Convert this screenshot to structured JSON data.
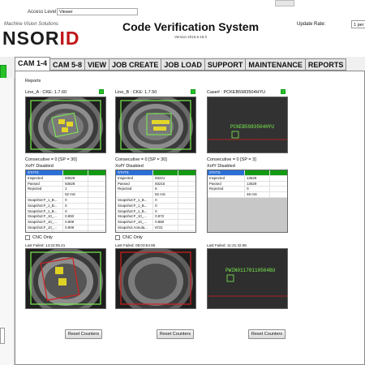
{
  "topbar": {
    "access_level_label": "Access Level",
    "access_level_value": "Viewer"
  },
  "brand": {
    "subtitle": "Machine Vision Solutions",
    "logo_main": "NSOR",
    "logo_accent": "ID"
  },
  "header": {
    "title": "Code Verification System",
    "version": "Version 2016.8.16.0",
    "update_rate_label": "Update Rate:",
    "update_rate_value": "1 per"
  },
  "tabs": [
    "CAM 1-4",
    "CAM 5-8",
    "VIEW",
    "JOB CREATE",
    "JOB LOAD",
    "SUPPORT",
    "MAINTENANCE",
    "REPORTS"
  ],
  "content": {
    "section_label": "Reports"
  },
  "colors": {
    "status_ok": "#27c227",
    "stats_header_blue": "#2b6fd6",
    "stats_header_green": "#129a12",
    "overlay_green": "#7cf050",
    "overlay_red": "#d02020",
    "overlay_yellow": "#f0e020"
  },
  "cameras": [
    {
      "title": "Line_A : CKE: 1.7.60",
      "consecutive": "Consecutive = 0 [SP = 30]",
      "xofy": "XofY Disabled",
      "stats": {
        "header": "STATS",
        "rows": [
          {
            "label": "Inspected",
            "value": "83629"
          },
          {
            "label": "Passed",
            "value": "83628"
          },
          {
            "label": "Rejected",
            "value": "1"
          },
          {
            "label": "",
            "value": "52 mS"
          },
          {
            "label": "Snapshot:F_1_B...",
            "value": "0"
          },
          {
            "label": "Snapshot:F_1_B...",
            "value": "0"
          },
          {
            "label": "Snapshot:F_1_B...",
            "value": "0"
          },
          {
            "label": "Snapshot:F_10_...",
            "value": "0.893"
          },
          {
            "label": "Snapshot:F_10_...",
            "value": "0.909"
          },
          {
            "label": "Snapshot:F_10_...",
            "value": "0.909"
          },
          {
            "label": "Snapshot Annula...",
            "value": "6683"
          }
        ]
      },
      "cnc_label": "CNC Only",
      "last_failed": "Last Failed: 14:22:05.21",
      "reset_label": "Reset Counters"
    },
    {
      "title": "Line_B : CKE: 1.7.50",
      "consecutive": "Consecutive = 0 [SP = 30]",
      "xofy": "XofY Disabled",
      "stats": {
        "header": "STATS",
        "rows": [
          {
            "label": "Inspected",
            "value": "83221"
          },
          {
            "label": "Passed",
            "value": "83215"
          },
          {
            "label": "Rejected",
            "value": "6"
          },
          {
            "label": "",
            "value": "52 mS"
          },
          {
            "label": "Snapshot:F_1_B...",
            "value": "0"
          },
          {
            "label": "Snapshot:F_1_B...",
            "value": "0"
          },
          {
            "label": "Snapshot:F_1_B...",
            "value": "0"
          },
          {
            "label": "Snapshot:F_10_...",
            "value": "0.972"
          },
          {
            "label": "Snapshot:F_10_...",
            "value": "0.880"
          },
          {
            "label": "Snapshot Annula...",
            "value": "6721"
          }
        ]
      },
      "cnc_label": "CNC Only",
      "last_failed": "Last Failed: 08:03:54.95",
      "reset_label": "Reset Counters"
    },
    {
      "title": "Case# : PCKEB5983504HYU",
      "consecutive": "Consecutive = 0 [SP = 3]",
      "xofy": "XofY Disabled",
      "stats": {
        "header": "STATS",
        "rows": [
          {
            "label": "Inspected",
            "value": "13529"
          },
          {
            "label": "Passed",
            "value": "13529"
          },
          {
            "label": "Rejected",
            "value": "0"
          },
          {
            "label": "",
            "value": "48 mS"
          }
        ]
      },
      "cnc_label": "",
      "last_failed": "Last Failed: 11:21:42.96",
      "reset_label": "Reset Counters"
    }
  ],
  "overlays": {
    "cam3_live_code": "PCKEB5983504HYU",
    "cam3_fail_code": "PWIN01170110504BU"
  }
}
